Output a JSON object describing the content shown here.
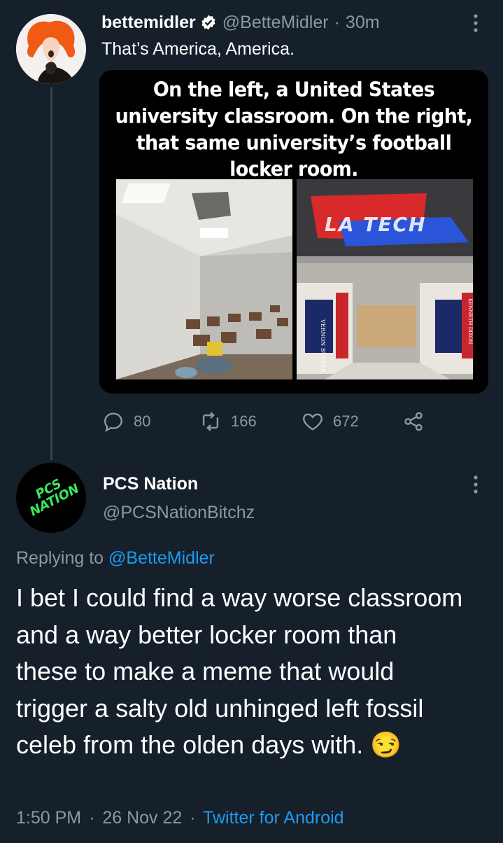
{
  "tweet": {
    "display_name": "bettemidler",
    "handle": "@BetteMidler",
    "separator": "·",
    "time_ago": "30m",
    "text": "That’s America, America.",
    "meme_caption": "On the left, a United States university classroom. On the right, that same university’s football locker room.",
    "banner_text": "LA TECH",
    "jersey_names": [
      "VERNON BUTLER",
      "KENNETH DIXON"
    ],
    "stats": {
      "replies": "80",
      "retweets": "166",
      "likes": "672"
    }
  },
  "reply": {
    "display_name": "PCS Nation",
    "handle": "@PCSNationBitchz",
    "avatar_text": "PCS NATION",
    "replying_prefix": "Replying to ",
    "replying_to": "@BetteMidler",
    "text": "I bet I could find a way worse classroom and a way better locker room than these to make a meme that would trigger a salty old unhinged left fossil celeb from the olden days with. 😏",
    "time": "1:50 PM",
    "dot1": "·",
    "date": "26 Nov 22",
    "dot2": "·",
    "source": "Twitter for Android"
  },
  "colors": {
    "background": "#15202b",
    "link": "#1d9bf0",
    "muted": "#8b98a5",
    "verified": "#ffffff",
    "avatar_green": "#39e75f",
    "avatar_orange": "#f05a14"
  }
}
